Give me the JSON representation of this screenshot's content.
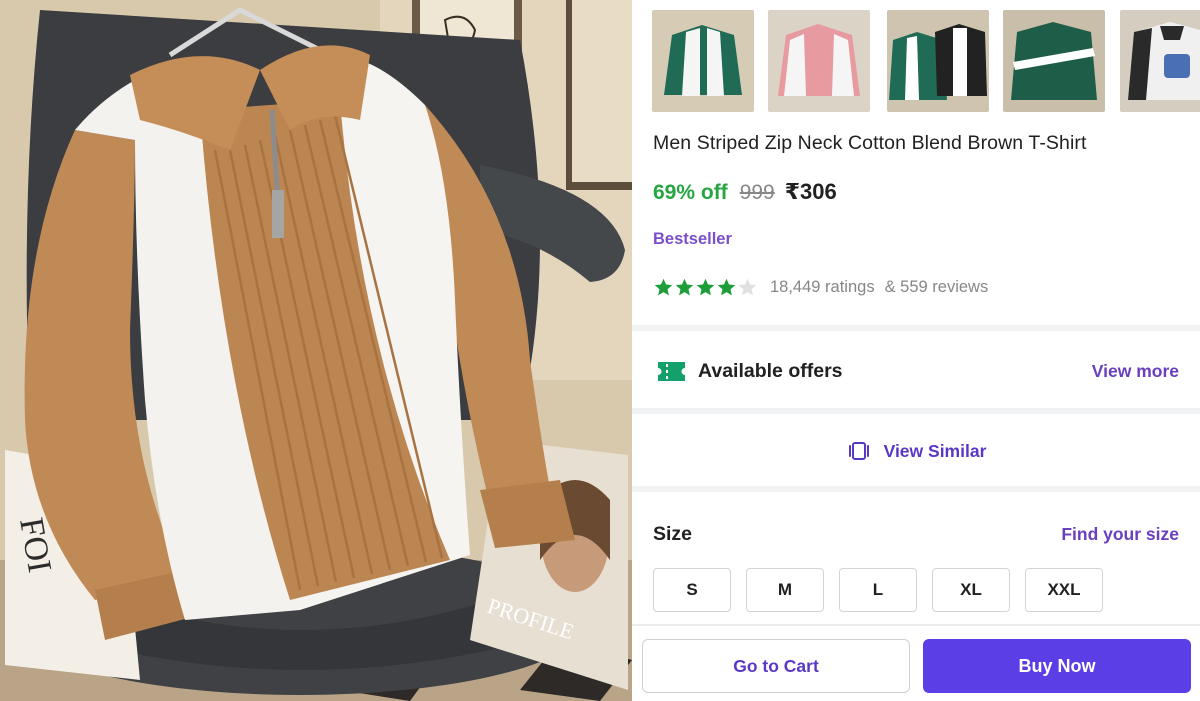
{
  "hero_image": {
    "icon": "product-photo-zip-neck-sweatshirt",
    "magazine_text": "PROFILE",
    "book_text": "FOI"
  },
  "thumbnails": [
    {
      "name": "green-white-variant",
      "body_color": "#1f6b55",
      "stripe_color": "#f5f5f5"
    },
    {
      "name": "pink-white-variant",
      "body_color": "#e79aa0",
      "stripe_color": "#f5f5f5"
    },
    {
      "name": "green-black-white-variant",
      "body_color": "#1f6b55",
      "stripe_color": "#ffffff"
    },
    {
      "name": "green-chevron-variant",
      "body_color": "#1e5d47",
      "stripe_color": "#ffffff"
    },
    {
      "name": "black-white-print-variant",
      "body_color": "#2a2a2a",
      "stripe_color": "#f0f0f0"
    }
  ],
  "product": {
    "title": "Men Striped Zip Neck Cotton Blend Brown T-Shirt",
    "discount": "69% off",
    "mrp": "999",
    "price": "₹306",
    "badge": "Bestseller",
    "rating_value": 4,
    "rating_max": 5,
    "ratings_text": "18,449 ratings",
    "reviews_text": "& 559 reviews"
  },
  "offers": {
    "label": "Available offers",
    "link": "View more"
  },
  "similar": {
    "label": "View Similar"
  },
  "size": {
    "heading": "Size",
    "link": "Find your size",
    "options": [
      "S",
      "M",
      "L",
      "XL",
      "XXL"
    ]
  },
  "actions": {
    "cart_label": "Go to Cart",
    "buy_label": "Buy Now"
  },
  "colors": {
    "discount_green": "#26a541",
    "star_green": "#1e9e3a",
    "accent_purple": "#5b3ee6",
    "link_purple": "#6a3fc0",
    "badge_purple": "#7b4fc9"
  }
}
